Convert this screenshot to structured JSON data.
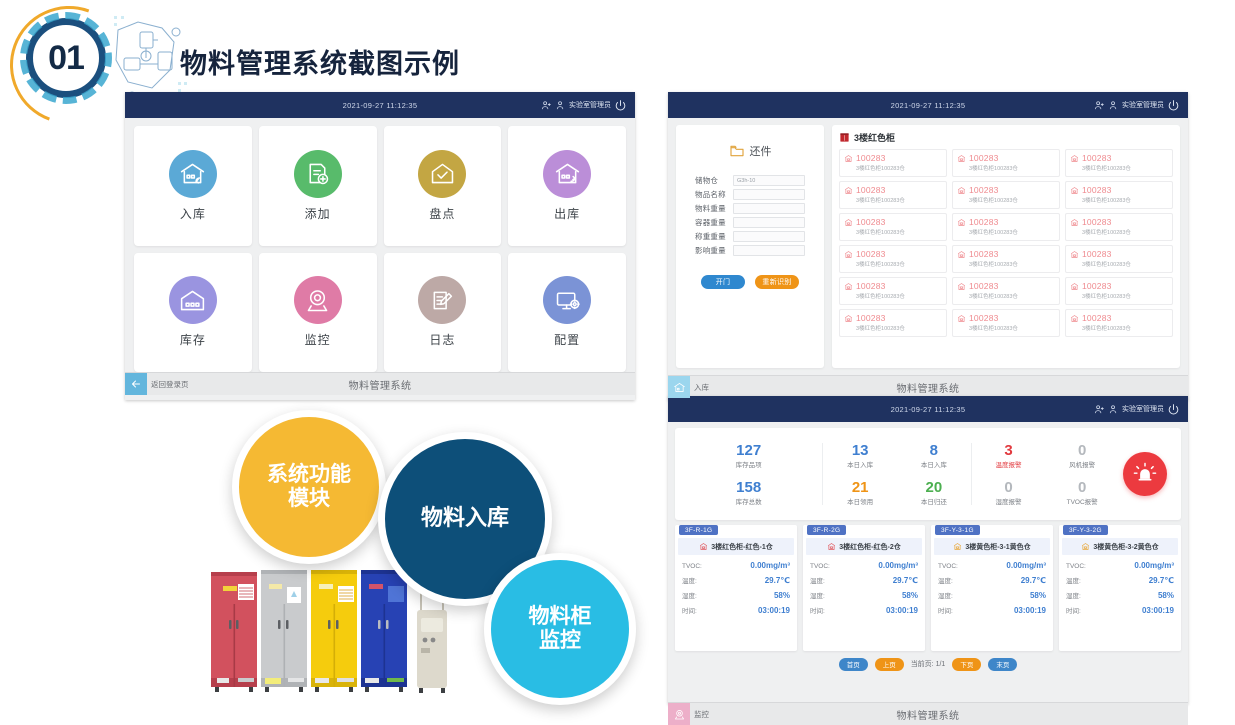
{
  "slide": {
    "number": "01",
    "title": "物料管理系统截图示例"
  },
  "common": {
    "clock": "2021-09-27  11:12:35",
    "user_name": "实验室管理员",
    "system_name": "物料管理系统",
    "user_icon": "user-icon",
    "user_add_icon": "user-account-icon",
    "power_icon": "power-icon"
  },
  "panel_menu": {
    "tiles": [
      {
        "label": "入库",
        "icon": "warehouse-in-icon",
        "color": "#5ba9d6"
      },
      {
        "label": "添加",
        "icon": "document-add-icon",
        "color": "#58bb6b"
      },
      {
        "label": "盘点",
        "icon": "check-house-icon",
        "color": "#c3a643"
      },
      {
        "label": "出库",
        "icon": "warehouse-out-icon",
        "color": "#bb8ed8"
      },
      {
        "label": "库存",
        "icon": "storage-icon",
        "color": "#9a94e0"
      },
      {
        "label": "监控",
        "icon": "camera-icon",
        "color": "#df7ba6"
      },
      {
        "label": "日志",
        "icon": "log-edit-icon",
        "color": "#bda9a6"
      },
      {
        "label": "配置",
        "icon": "monitor-gear-icon",
        "color": "#7b93d6"
      }
    ],
    "back_label": "返回登录页",
    "back_icon": "arrow-left-icon"
  },
  "panel_inbound": {
    "form_title": "还件",
    "form_title_icon": "folder-icon",
    "fields": [
      {
        "label": "储物仓",
        "value": "G3h-10",
        "placeholder": ""
      },
      {
        "label": "物品名称",
        "value": "",
        "placeholder": ""
      },
      {
        "label": "物料重量",
        "value": "",
        "placeholder": ""
      },
      {
        "label": "容器重量",
        "value": "",
        "placeholder": ""
      },
      {
        "label": "称重重量",
        "value": "",
        "placeholder": ""
      },
      {
        "label": "影响重量",
        "value": "",
        "placeholder": ""
      }
    ],
    "buttons": {
      "open_door": "开门",
      "rescan": "重新识别"
    },
    "cabinet_header": "3楼红色柜",
    "cabinet_header_icon": "cabinet-icon",
    "cells": [
      {
        "code": "100283",
        "sub": "3楼红色柜100283仓"
      },
      {
        "code": "100283",
        "sub": "3楼红色柜100283仓"
      },
      {
        "code": "100283",
        "sub": "3楼红色柜100283仓"
      },
      {
        "code": "100283",
        "sub": "3楼红色柜100283仓"
      },
      {
        "code": "100283",
        "sub": "3楼红色柜100283仓"
      },
      {
        "code": "100283",
        "sub": "3楼红色柜100283仓"
      },
      {
        "code": "100283",
        "sub": "3楼红色柜100283仓"
      },
      {
        "code": "100283",
        "sub": "3楼红色柜100283仓"
      },
      {
        "code": "100283",
        "sub": "3楼红色柜100283仓"
      },
      {
        "code": "100283",
        "sub": "3楼红色柜100283仓"
      },
      {
        "code": "100283",
        "sub": "3楼红色柜100283仓"
      },
      {
        "code": "100283",
        "sub": "3楼红色柜100283仓"
      },
      {
        "code": "100283",
        "sub": "3楼红色柜100283仓"
      },
      {
        "code": "100283",
        "sub": "3楼红色柜100283仓"
      },
      {
        "code": "100283",
        "sub": "3楼红色柜100283仓"
      },
      {
        "code": "100283",
        "sub": "3楼红色柜100283仓"
      },
      {
        "code": "100283",
        "sub": "3楼红色柜100283仓"
      },
      {
        "code": "100283",
        "sub": "3楼红色柜100283仓"
      }
    ],
    "footer_label": "入库",
    "footer_icon": "warehouse-in-icon"
  },
  "panel_monitor": {
    "stats": {
      "group1": [
        {
          "value": "127",
          "label": "库存品项",
          "color": "#3f7fd0"
        },
        {
          "value": "158",
          "label": "库存总数",
          "color": "#3f7fd0"
        }
      ],
      "group2a": [
        {
          "value": "13",
          "label": "本日入库",
          "color": "#3f7fd0"
        },
        {
          "value": "21",
          "label": "本日领用",
          "color": "#ef9417"
        }
      ],
      "group2b": [
        {
          "value": "8",
          "label": "本日入库",
          "color": "#3f7fd0"
        },
        {
          "value": "20",
          "label": "本日归还",
          "color": "#4caf50"
        }
      ],
      "group3a": [
        {
          "value": "3",
          "label": "温度报警",
          "color": "#e23a3f"
        },
        {
          "value": "0",
          "label": "湿度报警",
          "color": "#b4b8bd"
        }
      ],
      "group3b": [
        {
          "value": "0",
          "label": "风机报警",
          "color": "#b4b8bd"
        },
        {
          "value": "0",
          "label": "TVOC报警",
          "color": "#b4b8bd"
        }
      ]
    },
    "alarm_icon": "alarm-bell-icon",
    "cards": [
      {
        "tag": "3F-R-1G",
        "title": "3楼红色柜-红色-1仓",
        "icon": "cabinet-red-icon",
        "rows": [
          {
            "key": "TVOC:",
            "value": "0.00mg/m³"
          },
          {
            "key": "温度:",
            "value": "29.7℃"
          },
          {
            "key": "湿度:",
            "value": "58%"
          },
          {
            "key": "时间:",
            "value": "03:00:19"
          }
        ]
      },
      {
        "tag": "3F-R-2G",
        "title": "3楼红色柜-红色-2仓",
        "icon": "cabinet-red-icon",
        "rows": [
          {
            "key": "TVOC:",
            "value": "0.00mg/m³"
          },
          {
            "key": "温度:",
            "value": "29.7℃"
          },
          {
            "key": "湿度:",
            "value": "58%"
          },
          {
            "key": "时间:",
            "value": "03:00:19"
          }
        ]
      },
      {
        "tag": "3F-Y-3-1G",
        "title": "3楼黄色柜-3-1黄色仓",
        "icon": "cabinet-yellow-icon",
        "rows": [
          {
            "key": "TVOC:",
            "value": "0.00mg/m³"
          },
          {
            "key": "温度:",
            "value": "29.7℃"
          },
          {
            "key": "湿度:",
            "value": "58%"
          },
          {
            "key": "时间:",
            "value": "03:00:19"
          }
        ]
      },
      {
        "tag": "3F-Y-3-2G",
        "title": "3楼黄色柜-3-2黄色仓",
        "icon": "cabinet-yellow-icon",
        "rows": [
          {
            "key": "TVOC:",
            "value": "0.00mg/m³"
          },
          {
            "key": "温度:",
            "value": "29.7℃"
          },
          {
            "key": "湿度:",
            "value": "58%"
          },
          {
            "key": "时间:",
            "value": "03:00:19"
          }
        ]
      }
    ],
    "pager": {
      "first": "首页",
      "prev": "上页",
      "current": "当前页: 1/1",
      "next": "下页",
      "last": "末页"
    },
    "footer_label": "监控",
    "footer_icon": "camera-icon"
  },
  "badges": [
    {
      "line1": "系统功能",
      "line2": "模块",
      "color": "#f5b933"
    },
    {
      "line1": "物料入库",
      "line2": "",
      "color": "#0d4f79"
    },
    {
      "line1": "物料柜",
      "line2": "监控",
      "color": "#29bde4"
    }
  ],
  "cabinet_photo": {
    "alt": "material-cabinets-photo",
    "cabinets": [
      "#d2515e",
      "#c9cbcd",
      "#f5cc0d",
      "#2742b4",
      "#ddd9cc"
    ]
  }
}
